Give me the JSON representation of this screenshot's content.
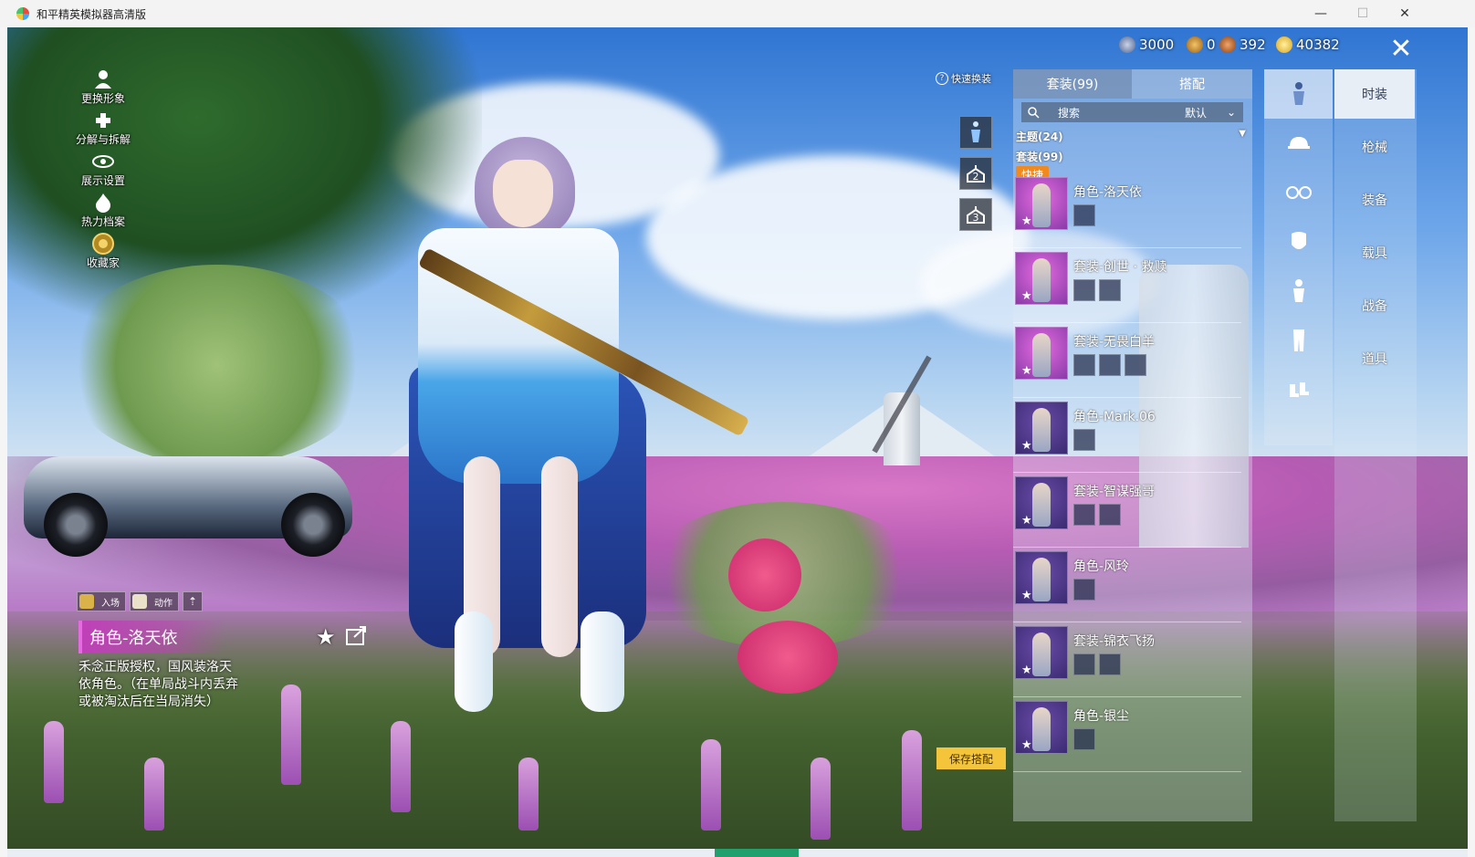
{
  "window": {
    "title": "和平精英模拟器高清版",
    "minimize": "—",
    "maximize": "☐",
    "close": "✕"
  },
  "left_menu": [
    {
      "label": "更换形象",
      "icon": "person-icon"
    },
    {
      "label": "分解与拆解",
      "icon": "puzzle-icon"
    },
    {
      "label": "展示设置",
      "icon": "eye-icon"
    },
    {
      "label": "热力档案",
      "icon": "flame-icon"
    },
    {
      "label": "收藏家",
      "icon": "collector-badge-icon"
    }
  ],
  "character_info": {
    "tab_enter": "入场",
    "tab_action": "动作",
    "up_arrow": "⇡",
    "name": "角色-洛天依",
    "description": "禾念正版授权，国风装洛天依角色。（在单局战斗内丢弃或被淘汰后在当局消失）"
  },
  "quick_change": {
    "label": "快速换装",
    "help": "?",
    "slots": [
      "",
      "2",
      "3"
    ]
  },
  "currency": [
    {
      "value": "3000",
      "color": "#6b7fa8"
    },
    {
      "value": "0",
      "color": "#d99a2b"
    },
    {
      "value": "392",
      "color": "#c8702e"
    },
    {
      "value": "40382",
      "color": "#f2c230"
    }
  ],
  "panel": {
    "tab_outfits": "套装(99)",
    "tab_match": "搭配",
    "search_placeholder": "搜索",
    "sort": "默认",
    "group_theme": "主题(24)",
    "group_outfit": "套装(99)",
    "quick_badge": "快捷",
    "items": [
      {
        "name": "角色-洛天依",
        "subs": 1,
        "color": "pink"
      },
      {
        "name": "套装-创世 · 救赎",
        "subs": 2,
        "color": "pink"
      },
      {
        "name": "套装-无畏白羊",
        "subs": 3,
        "color": "pink"
      },
      {
        "name": "角色-Mark.06",
        "subs": 1,
        "color": "purple"
      },
      {
        "name": "套装-智谋强哥",
        "subs": 2,
        "color": "purple"
      },
      {
        "name": "角色-风玲",
        "subs": 1,
        "color": "purple"
      },
      {
        "name": "套装-锦衣飞扬",
        "subs": 2,
        "color": "purple"
      },
      {
        "name": "角色-银尘",
        "subs": 1,
        "color": "purple"
      }
    ],
    "save_button": "保存搭配"
  },
  "slot_icons": [
    "full-outfit-icon",
    "hat-icon",
    "glasses-icon",
    "mask-icon",
    "top-icon",
    "pants-icon",
    "shoes-icon"
  ],
  "categories": [
    "时装",
    "枪械",
    "装备",
    "载具",
    "战备",
    "道具"
  ],
  "close_panel": "✕"
}
